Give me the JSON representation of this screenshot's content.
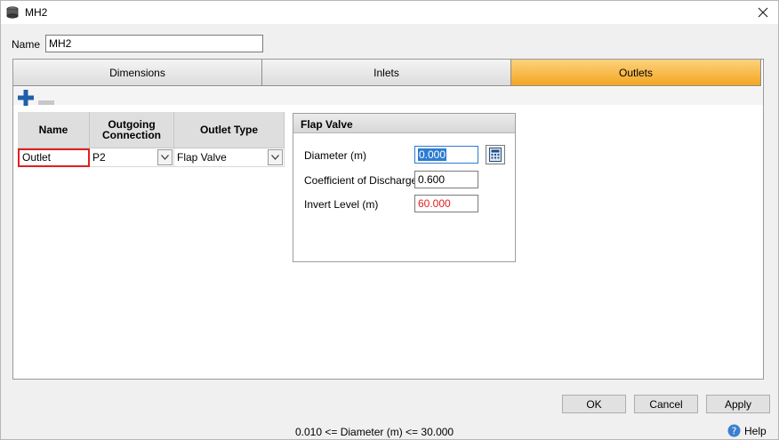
{
  "window": {
    "title": "MH2"
  },
  "name_field": {
    "label": "Name",
    "value": "MH2"
  },
  "tabs": [
    {
      "label": "Dimensions",
      "active": false
    },
    {
      "label": "Inlets",
      "active": false
    },
    {
      "label": "Outlets",
      "active": true
    }
  ],
  "grid": {
    "headers": [
      "Name",
      "Outgoing Connection",
      "Outlet Type"
    ],
    "rows": [
      {
        "name": "Outlet",
        "connection": "P2",
        "type": "Flap Valve"
      }
    ]
  },
  "flap_valve": {
    "title": "Flap Valve",
    "diameter_label": "Diameter (m)",
    "diameter_value": "0.000",
    "cd_label": "Coefficient of Discharge",
    "cd_value": "0.600",
    "invert_label": "Invert Level (m)",
    "invert_value": "60.000"
  },
  "buttons": {
    "ok": "OK",
    "cancel": "Cancel",
    "apply": "Apply"
  },
  "status": "0.010 <= Diameter (m) <= 30.000",
  "help": "Help",
  "colors": {
    "active_tab": "#f5b13a",
    "invalid": "#e02020",
    "accent": "#2d7bd1",
    "plus_icon": "#1f5fa8"
  },
  "icons": [
    "manhole-icon",
    "close-icon",
    "plus-icon",
    "minus-icon",
    "chevron-down-icon",
    "calculator-icon",
    "help-icon"
  ]
}
